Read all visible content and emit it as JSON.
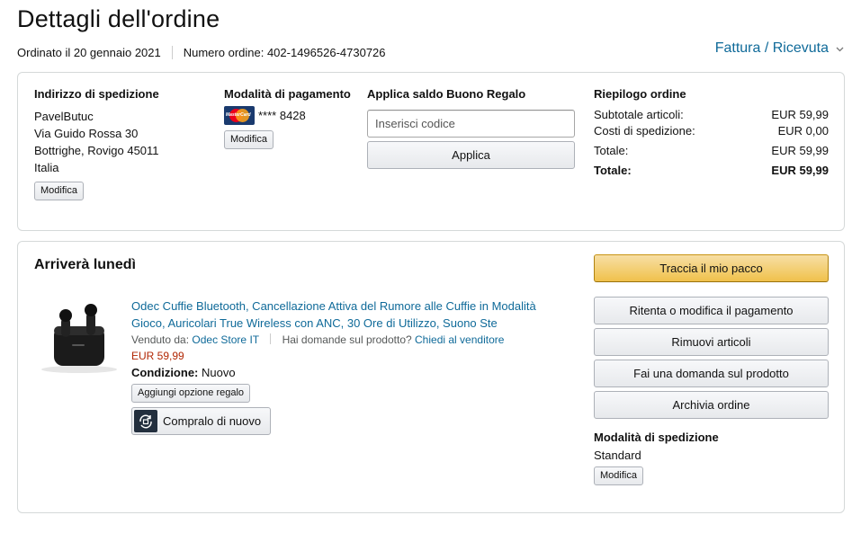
{
  "header": {
    "title": "Dettagli dell'ordine",
    "order_date": "Ordinato il 20 gennaio 2021",
    "order_number": "Numero ordine: 402-1496526-4730726",
    "invoice_link": "Fattura / Ricevuta"
  },
  "shipping_address": {
    "title": "Indirizzo di spedizione",
    "name": "PavelButuc",
    "street": "Via Guido Rossa 30",
    "city": "Bottrighe, Rovigo 45011",
    "country": "Italia",
    "edit_label": "Modifica"
  },
  "payment": {
    "title": "Modalità di pagamento",
    "card_brand_text": "MasterCard",
    "card_masked": "**** 8428",
    "edit_label": "Modifica"
  },
  "gift_balance": {
    "title": "Applica saldo Buono Regalo",
    "placeholder": "Inserisci codice",
    "apply_label": "Applica"
  },
  "summary": {
    "title": "Riepilogo ordine",
    "rows": [
      {
        "label": "Subtotale articoli:",
        "value": "EUR 59,99"
      },
      {
        "label": "Costi di spedizione:",
        "value": "EUR 0,00"
      },
      {
        "label": "Totale:",
        "value": "EUR 59,99"
      },
      {
        "label": "Totale:",
        "value": "EUR 59,99"
      }
    ]
  },
  "shipment": {
    "arrival": "Arriverà lunedì",
    "product": {
      "title": "Odec Cuffie Bluetooth, Cancellazione Attiva del Rumore alle Cuffie in Modalità Gioco, Auricolari True Wireless con ANC, 30 Ore di Utilizzo, Suono Ste",
      "sold_by_label": "Venduto da:",
      "seller": "Odec Store IT",
      "question_label": "Hai domande sul prodotto?",
      "ask_seller": "Chiedi al venditore",
      "price": "EUR 59,99",
      "condition_label": "Condizione:",
      "condition_value": "Nuovo",
      "gift_option": "Aggiungi opzione regalo",
      "buy_again": "Compralo di nuovo"
    },
    "actions": {
      "track": "Traccia il mio pacco",
      "retry_payment": "Ritenta o modifica il pagamento",
      "remove_items": "Rimuovi articoli",
      "ask_question": "Fai una domanda sul prodotto",
      "archive": "Archivia ordine"
    },
    "shipping_method": {
      "title": "Modalità di spedizione",
      "value": "Standard",
      "edit_label": "Modifica"
    }
  },
  "colors": {
    "link": "#0f6a99",
    "price": "#b12704",
    "primary_button": "#f0c14b",
    "border": "#d5d9d9"
  },
  "icons": [
    "chevron-down-icon",
    "mastercard-icon",
    "earbuds-product-image",
    "buy-again-icon"
  ]
}
